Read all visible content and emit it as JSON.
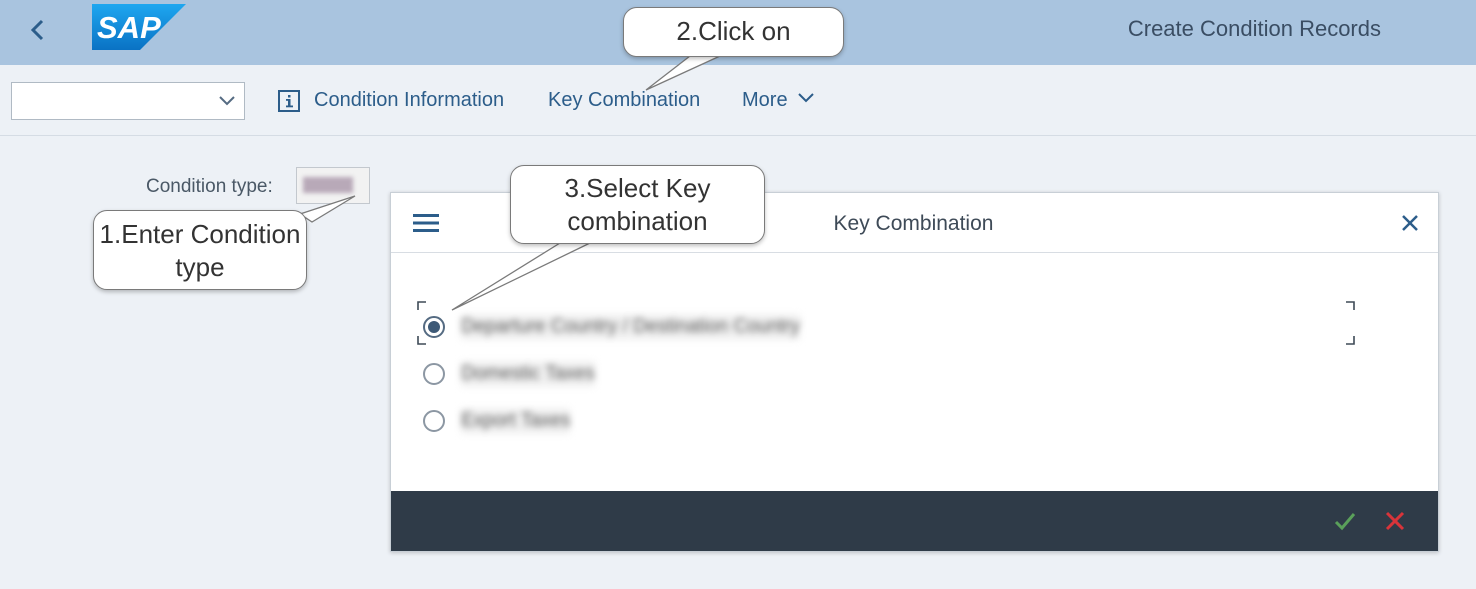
{
  "shell": {
    "title": "Create Condition Records",
    "logo_text": "SAP",
    "back_icon": "chevron-left-icon"
  },
  "toolbar": {
    "variant_value": "",
    "condition_info_label": "Condition Information",
    "key_combination_label": "Key Combination",
    "more_label": "More"
  },
  "form": {
    "condition_type_label": "Condition type:",
    "condition_type_value": ""
  },
  "dialog": {
    "title": "Key Combination",
    "options": [
      {
        "label": "Departure Country / Destination Country",
        "selected": true
      },
      {
        "label": "Domestic Taxes",
        "selected": false
      },
      {
        "label": "Export Taxes",
        "selected": false
      }
    ],
    "confirm_icon": "checkmark-icon",
    "cancel_icon": "cross-icon"
  },
  "callouts": {
    "step1": "1.Enter Condition type",
    "step2": "2.Click on",
    "step3": "3.Select Key combination"
  },
  "colors": {
    "shell_bg": "#a9c4df",
    "footer_bg": "#2f3b48",
    "link": "#2c5d8a",
    "ok": "#5aa05a",
    "cancel": "#d9343a"
  }
}
